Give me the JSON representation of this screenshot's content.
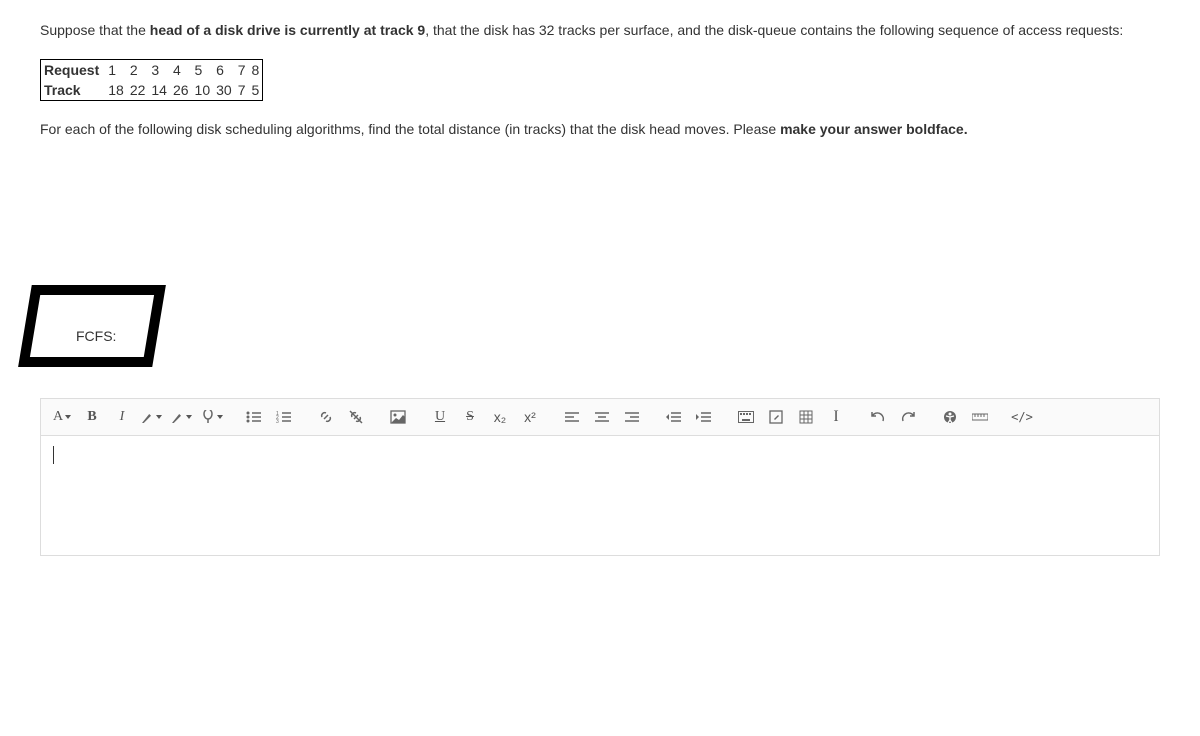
{
  "question": {
    "intro_pre": "Suppose that the ",
    "intro_bold": "head of a disk drive is currently at track 9",
    "intro_post": ", that the disk has 32 tracks per surface, and the disk-queue contains the following sequence of access requests:",
    "table": {
      "header_label": "Request",
      "row_label": "Track",
      "requests": [
        "1",
        "2",
        "3",
        "4",
        "5",
        "6",
        "7",
        "8"
      ],
      "tracks": [
        "18",
        "22",
        "14",
        "26",
        "10",
        "30",
        "7",
        "5"
      ]
    },
    "instruction_pre": "For each of the following disk scheduling algorithms, find the total distance (in tracks) that the disk head moves. Please ",
    "instruction_bold": "make your answer boldface.",
    "answer_label": "FCFS:"
  },
  "toolbar": {
    "font_family": "A",
    "bold": "B",
    "italic": "I",
    "underline": "U",
    "strike": "S",
    "sub": "x₂",
    "sup": "x²",
    "cursor": "I",
    "undo_title": "Undo",
    "redo_title": "Redo",
    "code": "</>"
  },
  "editor": {
    "content": ""
  }
}
